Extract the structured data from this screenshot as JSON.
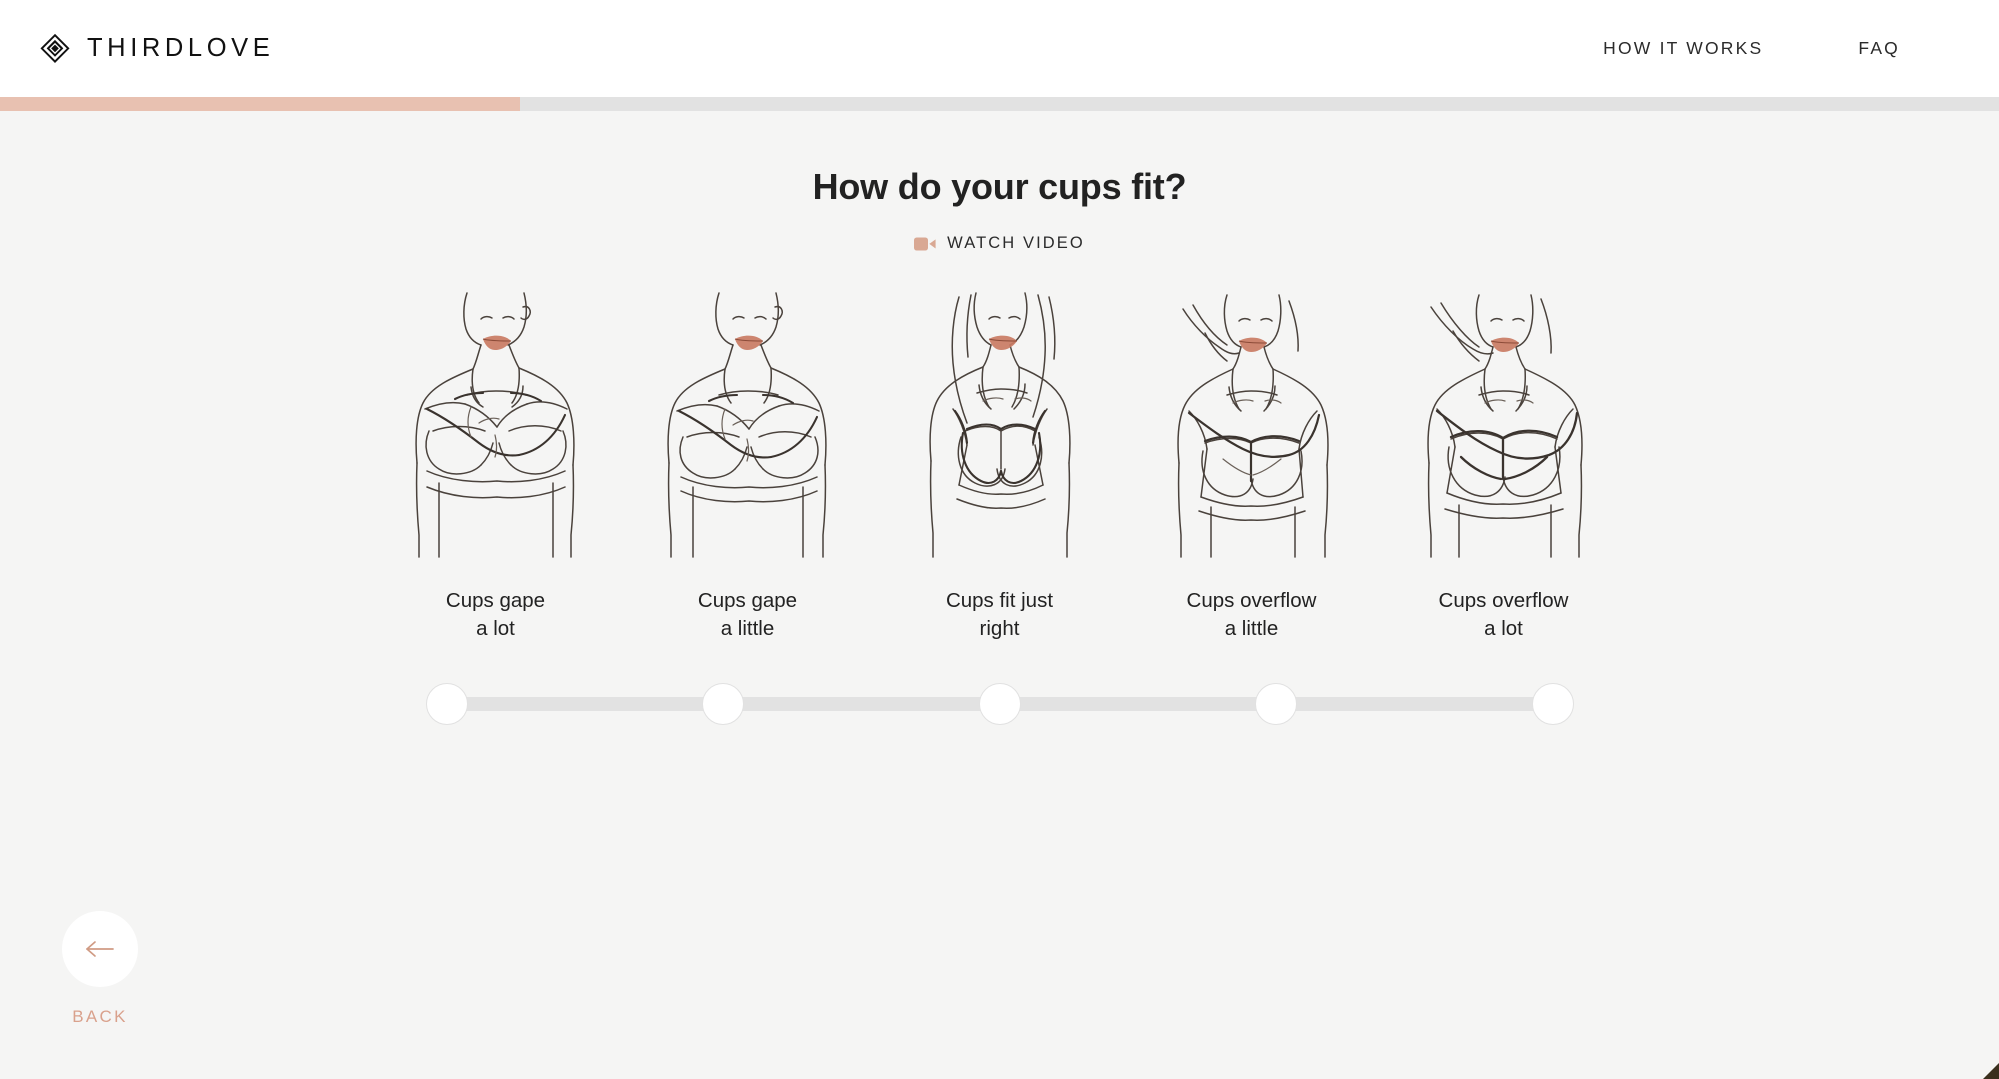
{
  "header": {
    "brand_name": "THIRDLOVE",
    "brand_mark_icon": "thirdlove-diamond-logo",
    "nav": [
      {
        "label": "HOW IT WORKS"
      },
      {
        "label": "FAQ"
      }
    ]
  },
  "progress": {
    "percent": 26,
    "fill_color": "#e8c1b1",
    "track_color": "#e2e2e2"
  },
  "main": {
    "title": "How do your cups fit?",
    "watch_video": {
      "label": "WATCH VIDEO",
      "icon": "video-camera-icon",
      "icon_color": "#d9a893"
    },
    "options": [
      {
        "id": "gape-a-lot",
        "label": "Cups gape\na lot",
        "art": "torso-cups-gape-a-lot"
      },
      {
        "id": "gape-a-little",
        "label": "Cups gape\na little",
        "art": "torso-cups-gape-a-little"
      },
      {
        "id": "fit-just-right",
        "label": "Cups fit just\nright",
        "art": "torso-cups-fit-just-right"
      },
      {
        "id": "overflow-little",
        "label": "Cups overflow\na little",
        "art": "torso-cups-overflow-a-little"
      },
      {
        "id": "overflow-a-lot",
        "label": "Cups overflow\na lot",
        "art": "torso-cups-overflow-a-lot"
      }
    ],
    "slider": {
      "stops": 5,
      "selected_index": null,
      "track_color": "#e2e2e2",
      "knob_color": "#ffffff"
    }
  },
  "footer": {
    "back": {
      "label": "BACK",
      "icon": "arrow-left-icon",
      "color": "#d9a18c"
    }
  },
  "theme": {
    "page_background": "#f5f5f4",
    "header_background": "#ffffff",
    "accent": "#e8c1b1",
    "text": "#222222"
  }
}
